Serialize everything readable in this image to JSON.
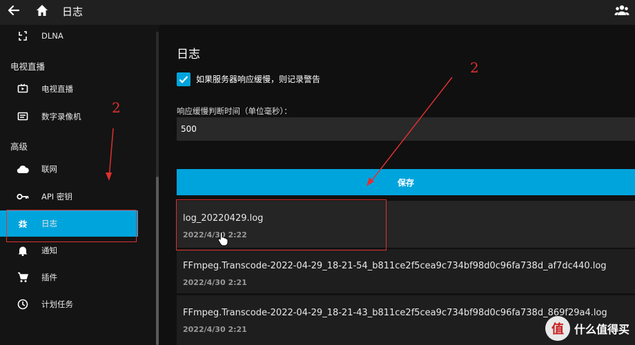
{
  "header": {
    "title": "日志"
  },
  "sidebar": {
    "items_top": [
      {
        "label": "DLNA",
        "icon": "dlna-icon"
      }
    ],
    "section_tv": "电视直播",
    "tv_items": [
      {
        "label": "电视直播",
        "icon": "tv-icon"
      },
      {
        "label": "数字录像机",
        "icon": "dvr-icon"
      }
    ],
    "section_advanced": "高级",
    "advanced_items": [
      {
        "label": "联网",
        "icon": "cloud-icon"
      },
      {
        "label": "API 密钥",
        "icon": "key-icon"
      },
      {
        "label": "日志",
        "icon": "bug-icon",
        "active": true
      },
      {
        "label": "通知",
        "icon": "bell-icon"
      },
      {
        "label": "插件",
        "icon": "cart-icon"
      },
      {
        "label": "计划任务",
        "icon": "clock-icon"
      }
    ]
  },
  "main": {
    "title": "日志",
    "slow_warning_label": "如果服务器响应缓慢，则记录警告",
    "slow_warning_checked": true,
    "threshold_label": "响应缓慢判断时间（单位毫秒）：",
    "threshold_value": "500",
    "save_label": "保存",
    "logs": [
      {
        "name": "log_20220429.log",
        "date": "2022/4/30 2:22"
      },
      {
        "name": "FFmpeg.Transcode-2022-04-29_18-21-54_b811ce2f5cea9c734bf98d0c96fa738d_af7dc440.log",
        "date": "2022/4/30 2:21"
      },
      {
        "name": "FFmpeg.Transcode-2022-04-29_18-21-43_b811ce2f5cea9c734bf98d0c96fa738d_869f29a4.log",
        "date": "2022/4/30 2:21"
      }
    ]
  },
  "annotations": {
    "marker_left": "2",
    "marker_right": "2"
  },
  "watermark": {
    "logo": "值",
    "text": "什么值得买"
  },
  "colors": {
    "accent": "#00a4dc",
    "annotation": "#e03030"
  }
}
